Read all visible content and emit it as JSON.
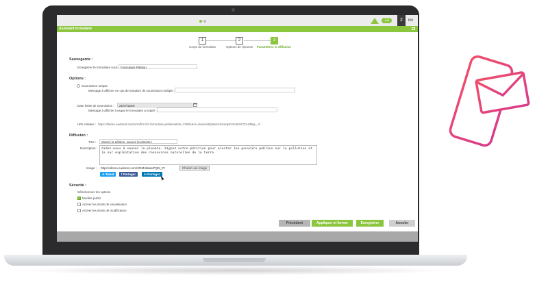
{
  "window": {
    "title": "Assistant formulaire"
  },
  "topbar": {
    "badge": "12",
    "user_initial": "2",
    "user_name": "Bo"
  },
  "steps": [
    {
      "number": "1",
      "label": "Corps du formulaire"
    },
    {
      "number": "2",
      "label": "Options de réponse"
    },
    {
      "number": "3",
      "label": "Paramètres et diffusion"
    }
  ],
  "save": {
    "section_title": "Sauvegarde :",
    "label": "Enregistrer le formulaire sous :",
    "value": "Formulaire Pétition"
  },
  "options": {
    "section_title": "Options :",
    "unique_label": "Soumission unique",
    "multi_msg_label": "Message à afficher en cas de tentative de soumission multiple :",
    "date_label": "Date limite de soumission :",
    "date_value": "21/07/2020",
    "expired_msg_label": "Message à afficher lorsque le formulaire a expiré :",
    "url_label": "URL relative :",
    "url_value": "https://demo.eudonet.com/xrm/frm?d=formulaire-petition&tok=73851&cs=be1wa9QMa2A0amdyE2Kc6XS7ZAZBkg=_F..."
  },
  "diffusion": {
    "section_title": "Diffusion :",
    "title_label": "Titre :",
    "title_value": "Signez la pétition, sauvez la planète !",
    "desc_label": "Description :",
    "desc_value": "Aidez-nous à sauver la planète. Signez notre pétition pour alerter les pouvoirs publics sur la pollution et la sur exploitation des ressources naturelles de la terre",
    "image_label": "Image :",
    "image_value": "https://demo.eudonet.com/XRM/datas/PQM_Pr",
    "choose_image": "Choisir une image",
    "share_buttons": [
      "Tweet",
      "Partager",
      "Partager"
    ]
  },
  "security": {
    "section_title": "Sécurité :",
    "select_label": "Sélectionnez les options",
    "items": [
      {
        "label": "Modèle public",
        "checked": true
      },
      {
        "label": "Activer les droits de visualisation",
        "checked": false
      },
      {
        "label": "Activer les droits de modification",
        "checked": false
      }
    ]
  },
  "footer_buttons": {
    "previous": "Précédent",
    "apply_close": "Appliquer et fermer",
    "save": "Enregistrer",
    "cancel": "Annuler"
  },
  "colors": {
    "accent": "#8cc63f",
    "twitter": "#1da1f2",
    "facebook": "#3b5998",
    "linkedin": "#0077b5",
    "illustration": "#e8436d"
  }
}
